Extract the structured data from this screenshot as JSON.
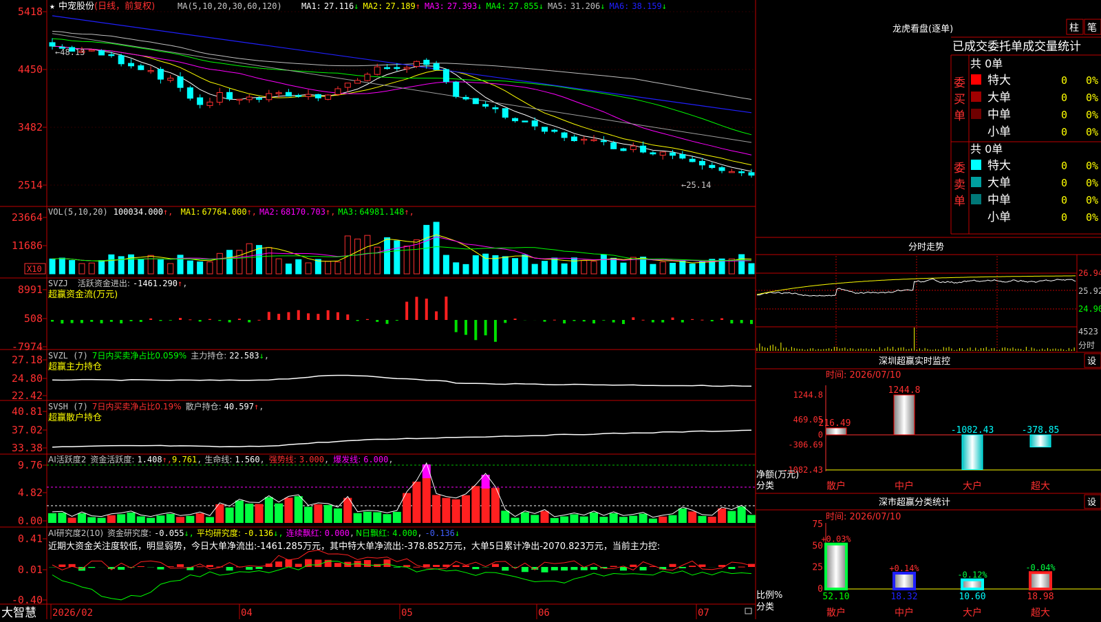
{
  "app_brand": "大智慧",
  "date_axis": [
    "2026/02",
    "04",
    "05",
    "06",
    "07"
  ],
  "stock": {
    "name": "中宠股份",
    "mode": "(日线，前复权)",
    "ma_title": "MA(5,10,20,30,60,120)",
    "ma_values": [
      {
        "label": "MA1:",
        "value": "27.116",
        "dir": "↓",
        "color": "#ffffff"
      },
      {
        "label": "MA2:",
        "value": "27.189",
        "dir": "↑",
        "color": "#ffff00"
      },
      {
        "label": "MA3:",
        "value": "27.393",
        "dir": "↓",
        "color": "#ff00ff"
      },
      {
        "label": "MA4:",
        "value": "27.855",
        "dir": "↓",
        "color": "#00ff00"
      },
      {
        "label": "MA5:",
        "value": "31.206",
        "dir": "↓",
        "color": "#c0c0c0"
      },
      {
        "label": "MA6:",
        "value": "38.159",
        "dir": "↓",
        "color": "#2020ff"
      }
    ],
    "price_axis": [
      "5418",
      "4450",
      "3482",
      "2514"
    ],
    "price_scale": [
      54.18,
      25.14
    ],
    "marker_high": "←48.13",
    "marker_low": "←25.14"
  },
  "volume": {
    "title": "VOL(5,10,20)",
    "value": "100034.000",
    "mas": [
      {
        "label": "MA1:",
        "value": "67764.000",
        "color": "#ffff00"
      },
      {
        "label": "MA2:",
        "value": "68170.703",
        "color": "#ff00ff"
      },
      {
        "label": "MA3:",
        "value": "64981.148",
        "color": "#00ff00"
      }
    ],
    "axis": [
      "23664",
      "11686"
    ],
    "unit": "X10"
  },
  "svzj": {
    "title": "SVZJ",
    "label": "活跃资金进出:",
    "value": "-1461.290",
    "sub": "超赢资金流(万元)",
    "axis": [
      "8991",
      "508",
      "-7974"
    ]
  },
  "svzl": {
    "title": "SVZL (7)",
    "desc": "7日内买卖净占比0.059%",
    "label": "主力持仓:",
    "value": "22.583",
    "sub": "超赢主力持仓",
    "axis": [
      "27.18",
      "24.80",
      "22.42"
    ]
  },
  "svsh": {
    "title": "SVSH (7)",
    "desc": "7日内买卖净占比0.19%",
    "label": "散户持仓:",
    "value": "40.597",
    "sub": "超赢散户持仓",
    "axis": [
      "40.81",
      "37.02",
      "33.38"
    ]
  },
  "ai2": {
    "title": "AI活跃度2",
    "label": "资金活跃度:",
    "value": "1.408",
    "v2": "9.761",
    "life_label": "生命线:",
    "life": "1.560",
    "strong_label": "强势线:",
    "strong": "3.000",
    "burst_label": "爆发线:",
    "burst": "6.000",
    "axis": [
      "9.76",
      "4.82",
      "0.00"
    ]
  },
  "ai_research": {
    "title": "AI研究度2(10)",
    "label": "资金研究度:",
    "value": "-0.055",
    "avg_label": "平均研究度:",
    "avg": "-0.136",
    "red_label": "连续飘红:",
    "red": "0.000",
    "nred_label": "N日飘红:",
    "nred": "4.000",
    "last": "-0.136",
    "comment": "近期大资金关注度较低，明显弱势，今日大单净流出:-1461.285万元，其中特大单净流出:-378.852万元，大单5日累计净出-2070.823万元，当前主力控:",
    "axis": [
      "0.41",
      "0.01",
      "-0.40"
    ]
  },
  "dragon": {
    "title": "龙虎看盘(逐单)",
    "btn1": "柱",
    "btn2": "笔",
    "tabs": [
      "已成交",
      "委托单",
      "成交量统计"
    ],
    "buy_label": [
      "委",
      "买",
      "单"
    ],
    "sell_label": [
      "委",
      "卖",
      "单"
    ],
    "buy_total": "共 0单",
    "sell_total": "共 0单",
    "buy_rows": [
      {
        "name": "特大",
        "count": "0",
        "pct": "0%",
        "color": "#ff0000"
      },
      {
        "name": "大单",
        "count": "0",
        "pct": "0%",
        "color": "#a00000"
      },
      {
        "name": "中单",
        "count": "0",
        "pct": "0%",
        "color": "#700000"
      },
      {
        "name": "小单",
        "count": "0",
        "pct": "0%",
        "color": "#000000"
      }
    ],
    "sell_rows": [
      {
        "name": "特大",
        "count": "0",
        "pct": "0%",
        "color": "#00ffff"
      },
      {
        "name": "大单",
        "count": "0",
        "pct": "0%",
        "color": "#00a0a0"
      },
      {
        "name": "中单",
        "count": "0",
        "pct": "0%",
        "color": "#007878"
      },
      {
        "name": "小单",
        "count": "0",
        "pct": "0%",
        "color": "#000000"
      }
    ]
  },
  "intraday": {
    "title": "分时走势",
    "prices": [
      "26.94",
      "25.92",
      "24.90"
    ],
    "vol": "4523",
    "vol_label": "分时"
  },
  "sz_monitor": {
    "title": "深圳超赢实时监控",
    "btn": "设",
    "time": "时间: 2026/07/10",
    "axis": [
      "1244.8",
      "469.05",
      "0",
      "-306.69",
      "-1082.43"
    ],
    "ylabel": "净额(万元)",
    "xlabel": "分类",
    "categories": [
      "散户",
      "中户",
      "大户",
      "超大"
    ],
    "values": [
      216.49,
      1244.8,
      -1082.43,
      -378.85
    ],
    "value_labels": [
      "216.49",
      "1244.8",
      "-1082.43",
      "-378.85"
    ]
  },
  "sz_classify": {
    "title": "深市超赢分类统计",
    "btn": "设",
    "time": "时间: 2026/07/10",
    "axis": [
      "75",
      "50",
      "25",
      "0"
    ],
    "ylabel": "比例%",
    "xlabel": "分类",
    "categories": [
      "散户",
      "中户",
      "大户",
      "超大"
    ],
    "values": [
      52.1,
      18.32,
      10.6,
      18.98
    ],
    "value_labels": [
      "52.10",
      "18.32",
      "10.60",
      "18.98"
    ],
    "changes": [
      "+0.03%",
      "+0.14%",
      "-0.12%",
      "-0.04%"
    ]
  }
}
